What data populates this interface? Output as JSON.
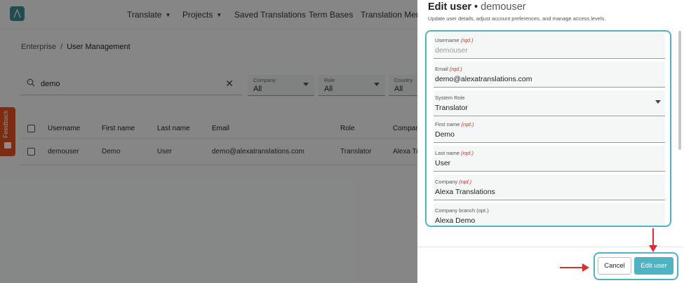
{
  "topnav": {
    "items": [
      {
        "label": "Translate",
        "has_menu": true
      },
      {
        "label": "Projects",
        "has_menu": true
      },
      {
        "label": "Saved Translations",
        "has_menu": false
      },
      {
        "label": "Term Bases",
        "has_menu": false
      },
      {
        "label": "Translation Memo",
        "has_menu": false
      }
    ]
  },
  "breadcrumb": {
    "parent": "Enterprise",
    "separator": "/",
    "current": "User Management"
  },
  "search": {
    "value": "demo",
    "icon": "search-icon",
    "clear_icon": "close-icon"
  },
  "filters": [
    {
      "label": "Company",
      "value": "All"
    },
    {
      "label": "Role",
      "value": "All"
    },
    {
      "label": "Country",
      "value": "All"
    }
  ],
  "table": {
    "headers": [
      "Username",
      "First name",
      "Last name",
      "Email",
      "Role",
      "Compan"
    ],
    "rows": [
      [
        "demouser",
        "Demo",
        "User",
        "demo@alexatranslations.com",
        "Translator",
        "Alexa Tra"
      ]
    ]
  },
  "feedback": {
    "label": "Feedback",
    "color": "#e2521f"
  },
  "drawer": {
    "title": "Edit user",
    "title_separator": "•",
    "subtitle": "demouser",
    "description": "Update user details, adjust account preferences, and manage access levels.",
    "fields": {
      "username": {
        "label": "Username",
        "tag": "(rqd.)",
        "value": "demouser"
      },
      "email": {
        "label": "Email",
        "tag": "(rqd.)",
        "value": "demo@alexatranslations.com"
      },
      "system_role": {
        "label": "System Role",
        "value": "Translator"
      },
      "first_name": {
        "label": "First name",
        "tag": "(rqd.)",
        "value": "Demo"
      },
      "last_name": {
        "label": "Last name",
        "tag": "(rqd.)",
        "value": "User"
      },
      "company": {
        "label": "Company",
        "tag": "(rqd.)",
        "value": "Alexa Translations"
      },
      "company_branch": {
        "label": "Company branch (opt.)",
        "value": "Alexa Demo"
      }
    },
    "buttons": {
      "cancel": "Cancel",
      "submit": "Edit user"
    }
  },
  "colors": {
    "accent": "#4fb3c3",
    "annotation_arrow": "#d9302b",
    "brand": "#3c8d8f",
    "required_tag": "#c0392b"
  }
}
